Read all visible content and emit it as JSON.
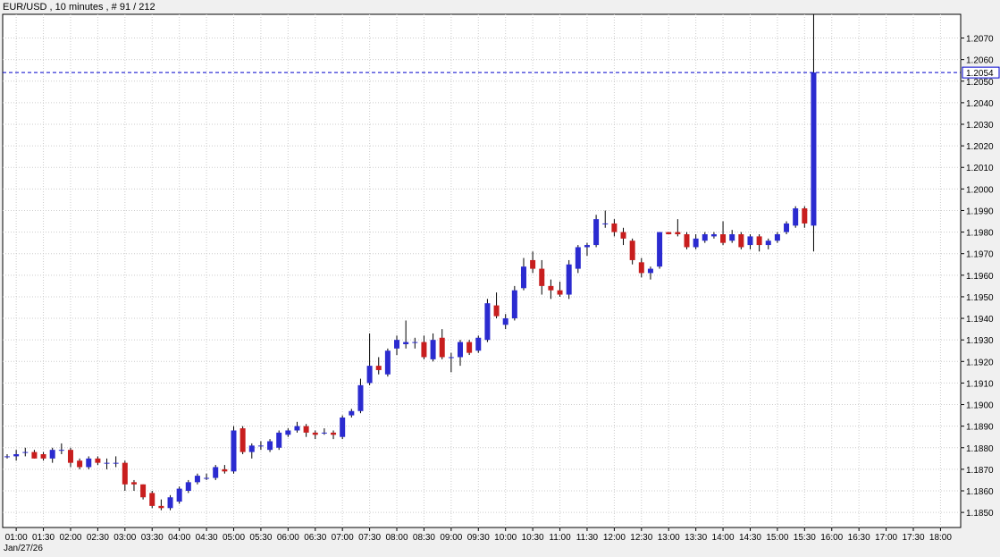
{
  "header": {
    "title": "EUR/USD , 10 minutes , # 91 / 212"
  },
  "footer": {
    "date": "Jan/27/26"
  },
  "colors": {
    "bull": "#2b2bd0",
    "bear": "#c81e1e",
    "wick": "#000000",
    "grid": "#cccccc",
    "price_line": "#0000cc",
    "background": "#ffffff"
  },
  "chart_data": {
    "type": "candlestick",
    "symbol": "EUR/USD",
    "timeframe": "10 minutes",
    "grid": true,
    "ylim": [
      1.1843,
      1.2081
    ],
    "y_ticks": [
      "1.1850",
      "1.1860",
      "1.1870",
      "1.1880",
      "1.1890",
      "1.1900",
      "1.1910",
      "1.1920",
      "1.1930",
      "1.1940",
      "1.1950",
      "1.1960",
      "1.1970",
      "1.1980",
      "1.1990",
      "1.2000",
      "1.2010",
      "1.2020",
      "1.2030",
      "1.2040",
      "1.2050",
      "1.2060",
      "1.2070"
    ],
    "x_ticks": [
      "01:00",
      "01:30",
      "02:00",
      "02:30",
      "03:00",
      "03:30",
      "04:00",
      "04:30",
      "05:00",
      "05:30",
      "06:00",
      "06:30",
      "07:00",
      "07:30",
      "08:00",
      "08:30",
      "09:00",
      "09:30",
      "10:00",
      "10:30",
      "11:00",
      "11:30",
      "12:00",
      "12:30",
      "13:00",
      "13:30",
      "14:00",
      "14:30",
      "15:00",
      "15:30",
      "16:00",
      "16:30",
      "17:00",
      "17:30",
      "18:00"
    ],
    "first_bar_time": "00:50",
    "current_price": "1.2054",
    "candles": [
      [
        1.1876,
        1.1877,
        1.1875,
        1.1876
      ],
      [
        1.1876,
        1.1879,
        1.1874,
        1.1877
      ],
      [
        1.1878,
        1.188,
        1.1876,
        1.1878
      ],
      [
        1.1878,
        1.1879,
        1.1875,
        1.1875
      ],
      [
        1.1877,
        1.1878,
        1.1874,
        1.1875
      ],
      [
        1.1875,
        1.188,
        1.1873,
        1.1879
      ],
      [
        1.1879,
        1.1882,
        1.1877,
        1.1879
      ],
      [
        1.1879,
        1.188,
        1.1871,
        1.1873
      ],
      [
        1.1874,
        1.1875,
        1.187,
        1.1871
      ],
      [
        1.1871,
        1.1876,
        1.187,
        1.1875
      ],
      [
        1.1875,
        1.1876,
        1.1872,
        1.1873
      ],
      [
        1.1873,
        1.1875,
        1.187,
        1.1873
      ],
      [
        1.1873,
        1.1876,
        1.1871,
        1.1873
      ],
      [
        1.1873,
        1.1874,
        1.186,
        1.1863
      ],
      [
        1.1864,
        1.1865,
        1.186,
        1.1863
      ],
      [
        1.1863,
        1.1863,
        1.1856,
        1.1857
      ],
      [
        1.1859,
        1.186,
        1.1852,
        1.1853
      ],
      [
        1.1853,
        1.1856,
        1.1851,
        1.1852
      ],
      [
        1.1852,
        1.1858,
        1.1851,
        1.1857
      ],
      [
        1.1855,
        1.1862,
        1.1854,
        1.1861
      ],
      [
        1.186,
        1.1865,
        1.1859,
        1.1864
      ],
      [
        1.1864,
        1.1868,
        1.1863,
        1.1867
      ],
      [
        1.1866,
        1.1868,
        1.1865,
        1.1866
      ],
      [
        1.1866,
        1.1872,
        1.1865,
        1.1871
      ],
      [
        1.187,
        1.1872,
        1.1868,
        1.1869
      ],
      [
        1.1869,
        1.189,
        1.1868,
        1.1888
      ],
      [
        1.1889,
        1.189,
        1.1877,
        1.1878
      ],
      [
        1.1878,
        1.1882,
        1.1875,
        1.1881
      ],
      [
        1.1881,
        1.1883,
        1.1879,
        1.1881
      ],
      [
        1.1879,
        1.1884,
        1.1878,
        1.1883
      ],
      [
        1.188,
        1.1888,
        1.1879,
        1.1887
      ],
      [
        1.1886,
        1.1889,
        1.1885,
        1.1888
      ],
      [
        1.1888,
        1.1892,
        1.1887,
        1.189
      ],
      [
        1.189,
        1.1891,
        1.1885,
        1.1887
      ],
      [
        1.1887,
        1.1888,
        1.1884,
        1.1886
      ],
      [
        1.1887,
        1.1889,
        1.1886,
        1.1887
      ],
      [
        1.1887,
        1.1888,
        1.1884,
        1.1886
      ],
      [
        1.1885,
        1.1895,
        1.1884,
        1.1894
      ],
      [
        1.1895,
        1.1898,
        1.1894,
        1.1897
      ],
      [
        1.1897,
        1.1912,
        1.1896,
        1.1909
      ],
      [
        1.191,
        1.1933,
        1.1909,
        1.1918
      ],
      [
        1.1918,
        1.1922,
        1.1914,
        1.1916
      ],
      [
        1.1914,
        1.1926,
        1.1913,
        1.1925
      ],
      [
        1.1926,
        1.1932,
        1.1923,
        1.193
      ],
      [
        1.1928,
        1.1939,
        1.1926,
        1.1929
      ],
      [
        1.1929,
        1.1931,
        1.1926,
        1.1929
      ],
      [
        1.1929,
        1.1932,
        1.1921,
        1.1922
      ],
      [
        1.1921,
        1.1933,
        1.192,
        1.193
      ],
      [
        1.1931,
        1.1935,
        1.1921,
        1.1922
      ],
      [
        1.1922,
        1.1924,
        1.1915,
        1.1922
      ],
      [
        1.1922,
        1.193,
        1.1918,
        1.1929
      ],
      [
        1.1929,
        1.193,
        1.1923,
        1.1924
      ],
      [
        1.1925,
        1.1932,
        1.1924,
        1.1931
      ],
      [
        1.193,
        1.1949,
        1.1929,
        1.1947
      ],
      [
        1.1946,
        1.1952,
        1.194,
        1.1941
      ],
      [
        1.1937,
        1.1942,
        1.1935,
        1.194
      ],
      [
        1.194,
        1.1955,
        1.1939,
        1.1953
      ],
      [
        1.1954,
        1.1968,
        1.1953,
        1.1964
      ],
      [
        1.1967,
        1.1971,
        1.1961,
        1.1963
      ],
      [
        1.1963,
        1.1967,
        1.1951,
        1.1955
      ],
      [
        1.1955,
        1.1958,
        1.1949,
        1.1953
      ],
      [
        1.1953,
        1.1957,
        1.195,
        1.1951
      ],
      [
        1.1951,
        1.1967,
        1.1949,
        1.1965
      ],
      [
        1.1963,
        1.1974,
        1.1961,
        1.1973
      ],
      [
        1.1973,
        1.1975,
        1.1969,
        1.1974
      ],
      [
        1.1974,
        1.1988,
        1.1973,
        1.1986
      ],
      [
        1.1984,
        1.199,
        1.1982,
        1.1984
      ],
      [
        1.1984,
        1.1986,
        1.1978,
        1.198
      ],
      [
        1.198,
        1.1982,
        1.1974,
        1.1977
      ],
      [
        1.1976,
        1.1977,
        1.1965,
        1.1967
      ],
      [
        1.1966,
        1.1968,
        1.1959,
        1.1961
      ],
      [
        1.1961,
        1.1964,
        1.1958,
        1.1963
      ],
      [
        1.1964,
        1.198,
        1.1963,
        1.198
      ],
      [
        1.198,
        1.198,
        1.1979,
        1.1979
      ],
      [
        1.198,
        1.1986,
        1.1978,
        1.1979
      ],
      [
        1.1979,
        1.198,
        1.1972,
        1.1973
      ],
      [
        1.1973,
        1.1979,
        1.1972,
        1.1977
      ],
      [
        1.1976,
        1.198,
        1.1975,
        1.1979
      ],
      [
        1.1978,
        1.198,
        1.1977,
        1.1979
      ],
      [
        1.1979,
        1.1985,
        1.1974,
        1.1975
      ],
      [
        1.1976,
        1.1981,
        1.1975,
        1.1979
      ],
      [
        1.1979,
        1.198,
        1.1972,
        1.1973
      ],
      [
        1.1974,
        1.1979,
        1.1972,
        1.1978
      ],
      [
        1.1978,
        1.1979,
        1.1971,
        1.1974
      ],
      [
        1.1974,
        1.1977,
        1.1972,
        1.1976
      ],
      [
        1.1976,
        1.198,
        1.1975,
        1.1979
      ],
      [
        1.198,
        1.1985,
        1.1979,
        1.1984
      ],
      [
        1.1983,
        1.1992,
        1.1982,
        1.1991
      ],
      [
        1.1991,
        1.1992,
        1.1982,
        1.1984
      ],
      [
        1.1983,
        1.2081,
        1.1971,
        1.2054
      ]
    ]
  }
}
